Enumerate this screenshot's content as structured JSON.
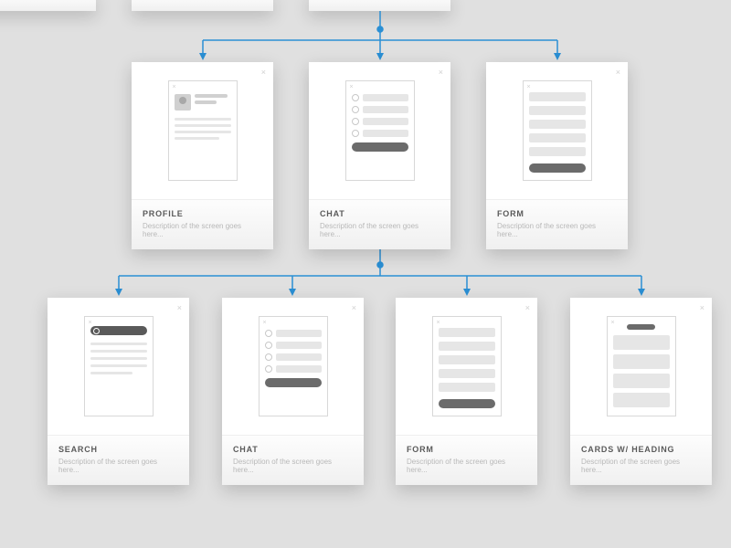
{
  "colors": {
    "connector": "#2a8fd4",
    "canvas": "#e0e0e0",
    "card_bg": "#ffffff",
    "title_text": "#5a5a5a",
    "desc_text": "#b8b8b8"
  },
  "common": {
    "description": "Description of the screen goes here..."
  },
  "row1": [
    {
      "title": "PROFILE",
      "type": "profile"
    },
    {
      "title": "CHAT",
      "type": "chat"
    },
    {
      "title": "FORM",
      "type": "form"
    }
  ],
  "row2": [
    {
      "title": "SEARCH",
      "type": "search"
    },
    {
      "title": "CHAT",
      "type": "chat"
    },
    {
      "title": "FORM",
      "type": "form"
    },
    {
      "title": "CARDS W/ HEADING",
      "type": "cards"
    }
  ]
}
